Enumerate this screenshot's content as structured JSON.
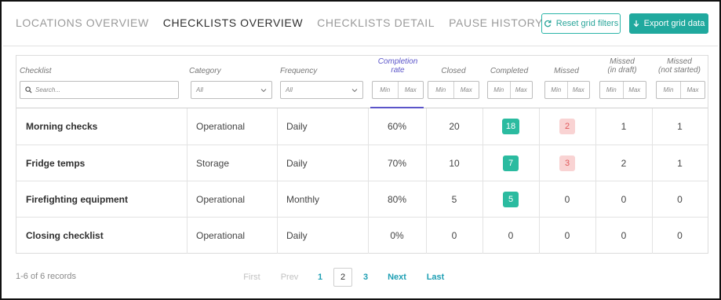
{
  "tabs": [
    {
      "label": "LOCATIONS OVERVIEW",
      "active": false
    },
    {
      "label": "CHECKLISTS OVERVIEW",
      "active": true
    },
    {
      "label": "CHECKLISTS DETAIL",
      "active": false
    },
    {
      "label": "PAUSE HISTORY",
      "active": false
    }
  ],
  "actions": {
    "reset_label": "Reset grid filters",
    "reset_icon": "refresh-icon",
    "export_label": "Export grid data",
    "export_icon": "download-arrow-icon",
    "accent_color": "#20a99e"
  },
  "columns": {
    "checklist": "Checklist",
    "category": "Category",
    "frequency": "Frequency",
    "completion_rate_1": "Completion",
    "completion_rate_2": "rate",
    "closed": "Closed",
    "completed": "Completed",
    "missed": "Missed",
    "missed_draft_1": "Missed",
    "missed_draft_2": "(in draft)",
    "missed_not_started_1": "Missed",
    "missed_not_started_2": "(not started)"
  },
  "filters": {
    "search_placeholder": "Search...",
    "category_value": "All",
    "frequency_value": "All",
    "min_label": "Min",
    "max_label": "Max"
  },
  "rows": [
    {
      "checklist": "Morning checks",
      "category": "Operational",
      "frequency": "Daily",
      "completion_rate": "60%",
      "closed": "20",
      "completed": "18",
      "missed": "2",
      "missed_draft": "1",
      "missed_not_started": "1"
    },
    {
      "checklist": "Fridge temps",
      "category": "Storage",
      "frequency": "Daily",
      "completion_rate": "70%",
      "closed": "10",
      "completed": "7",
      "missed": "3",
      "missed_draft": "2",
      "missed_not_started": "1"
    },
    {
      "checklist": "Firefighting equipment",
      "category": "Operational",
      "frequency": "Monthly",
      "completion_rate": "80%",
      "closed": "5",
      "completed": "5",
      "missed": "0",
      "missed_draft": "0",
      "missed_not_started": "0"
    },
    {
      "checklist": "Closing checklist",
      "category": "Operational",
      "frequency": "Daily",
      "completion_rate": "0%",
      "closed": "0",
      "completed": "0",
      "missed": "0",
      "missed_draft": "0",
      "missed_not_started": "0"
    }
  ],
  "badge_colors": {
    "completed": "#2bbba0",
    "missed_bg": "#f9d3d3",
    "missed_text": "#e0585a"
  },
  "footer": {
    "records": "1-6 of 6 records",
    "first": "First",
    "prev": "Prev",
    "pages": [
      "1",
      "2",
      "3"
    ],
    "current_page": "2",
    "next": "Next",
    "last": "Last"
  }
}
